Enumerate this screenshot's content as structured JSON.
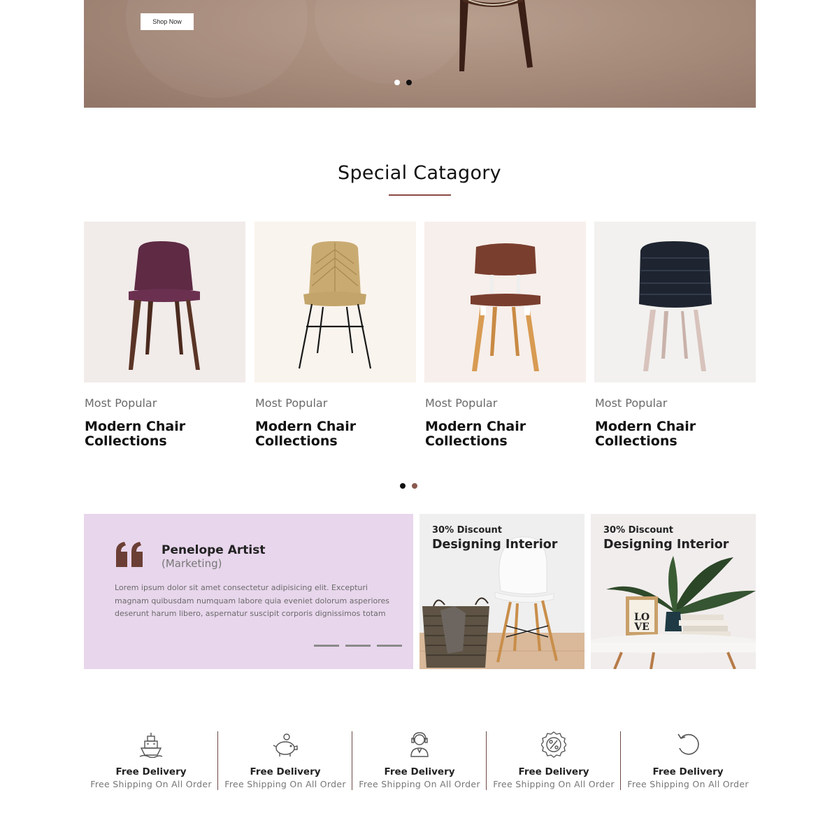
{
  "hero": {
    "button_label": "Shop Now",
    "slides": 2,
    "active_slide": 1
  },
  "section": {
    "title": "Special Catagory"
  },
  "categories": [
    {
      "subtitle": "Most Popular",
      "title": "Modern Chair Collections",
      "bg": "#f1ebe9",
      "seat": "#5e2a44"
    },
    {
      "subtitle": "Most Popular",
      "title": "Modern Chair Collections",
      "bg": "#faf4ee",
      "seat": "#c4a56e"
    },
    {
      "subtitle": "Most Popular",
      "title": "Modern Chair Collections",
      "bg": "#f7efeb",
      "seat": "#7a3e2e"
    },
    {
      "subtitle": "Most Popular",
      "title": "Modern Chair Collections",
      "bg": "#f2f1ef",
      "seat": "#1e2430"
    }
  ],
  "category_pager": {
    "slides": 2,
    "active_slide": 1
  },
  "testimonial": {
    "name": "Penelope Artist",
    "role": "(Marketing)",
    "text": "Lorem ipsum dolor sit amet consectetur adipisicing elit. Excepturi magnam quibusdam numquam labore quia eveniet dolorum asperiores deserunt harum libero, aspernatur suscipit corporis dignissimos totam",
    "bg": "#e8d6ec",
    "quote_color": "#6b3f35"
  },
  "promos": [
    {
      "subtitle": "30% Discount",
      "title": "Designing Interior"
    },
    {
      "subtitle": "30% Discount",
      "title": "Designing Interior"
    }
  ],
  "features": [
    {
      "icon": "ship-icon",
      "title": "Free Delivery",
      "subtitle": "Free Shipping On All Order"
    },
    {
      "icon": "piggy-bank-icon",
      "title": "Free Delivery",
      "subtitle": "Free Shipping On All Order"
    },
    {
      "icon": "support-agent-icon",
      "title": "Free Delivery",
      "subtitle": "Free Shipping On All Order"
    },
    {
      "icon": "discount-badge-icon",
      "title": "Free Delivery",
      "subtitle": "Free Shipping On All Order"
    },
    {
      "icon": "refresh-icon",
      "title": "Free Delivery",
      "subtitle": "Free Shipping On All Order"
    }
  ],
  "colors": {
    "accent": "#8a4a43",
    "separator": "#6b4a43"
  }
}
